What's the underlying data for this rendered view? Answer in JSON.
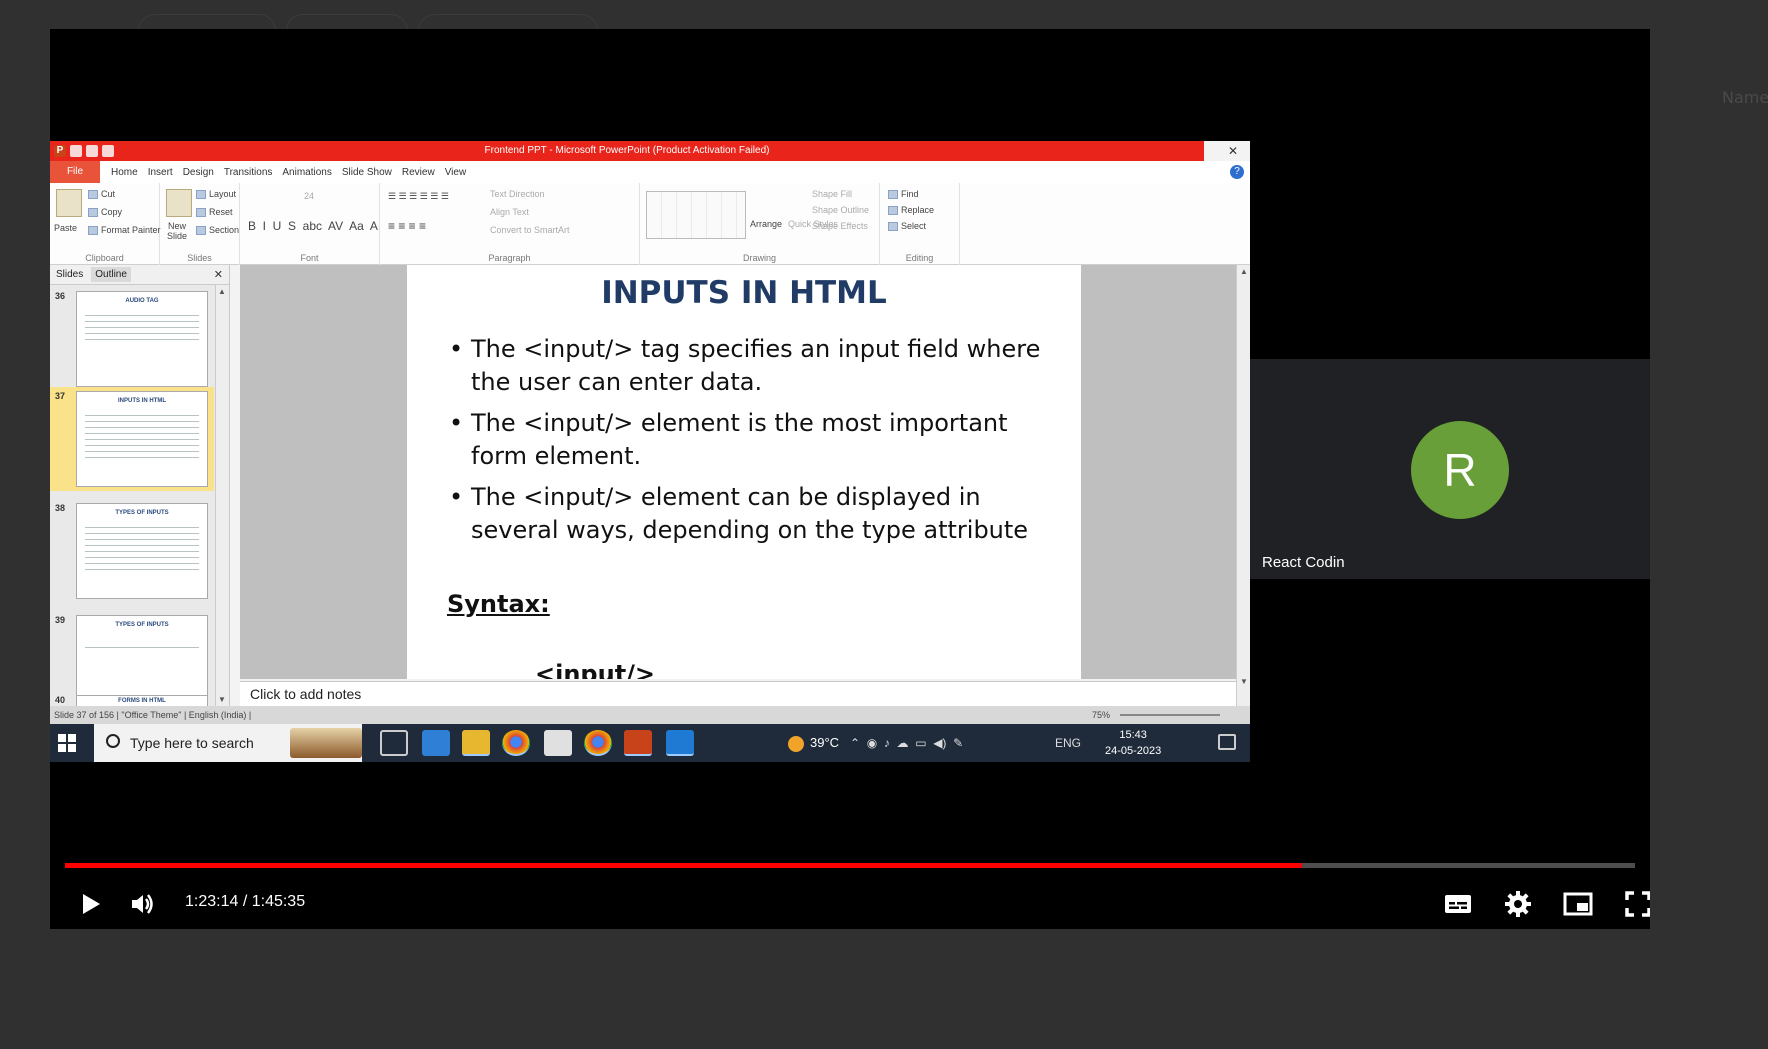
{
  "background": {
    "chips": [
      "",
      "",
      ""
    ],
    "name_label": "Name"
  },
  "ppt": {
    "window_title": "Frontend PPT - Microsoft PowerPoint (Product Activation Failed)",
    "ribbon_tabs": [
      "File",
      "Home",
      "Insert",
      "Design",
      "Transitions",
      "Animations",
      "Slide Show",
      "Review",
      "View"
    ],
    "ribbon": {
      "clipboard": {
        "paste": "Paste",
        "cut": "Cut",
        "copy": "Copy",
        "format_painter": "Format Painter",
        "label": "Clipboard"
      },
      "slides": {
        "new_slide": "New Slide",
        "layout": "Layout",
        "reset": "Reset",
        "section": "Section",
        "label": "Slides"
      },
      "font": {
        "size": "24",
        "label": "Font"
      },
      "paragraph": {
        "text_direction": "Text Direction",
        "align_text": "Align Text",
        "convert_smartart": "Convert to SmartArt",
        "label": "Paragraph"
      },
      "drawing": {
        "arrange": "Arrange",
        "quick_styles": "Quick Styles",
        "shape_fill": "Shape Fill",
        "shape_outline": "Shape Outline",
        "shape_effects": "Shape Effects",
        "label": "Drawing"
      },
      "editing": {
        "find": "Find",
        "replace": "Replace",
        "select": "Select",
        "label": "Editing"
      }
    },
    "pane_tabs": {
      "slides": "Slides",
      "outline": "Outline"
    },
    "thumbnails": [
      {
        "num": "36",
        "title": "AUDIO TAG"
      },
      {
        "num": "37",
        "title": "INPUTS IN HTML"
      },
      {
        "num": "38",
        "title": "TYPES OF INPUTS"
      },
      {
        "num": "39",
        "title": "TYPES OF INPUTS"
      },
      {
        "num": "40",
        "title": "FORMS IN HTML"
      }
    ],
    "slide": {
      "title": "INPUTS IN HTML",
      "bullets": [
        "The <input/> tag specifies an input field where the user can enter data.",
        "The <input/> element is the most important form element.",
        "The <input/> element can be displayed in several ways, depending on the type attribute"
      ],
      "syntax_label": "Syntax:",
      "syntax_code": "<input/>"
    },
    "notes_placeholder": "Click to add notes",
    "status": {
      "left": "Slide 37 of 156 | \"Office Theme\" | English (India) |",
      "zoom": "75%"
    }
  },
  "taskbar": {
    "search_placeholder": "Type here to search",
    "weather": "39°C",
    "language": "ENG",
    "time": "15:43",
    "date": "24-05-2023"
  },
  "participant": {
    "initial": "R",
    "name": "React Codin",
    "avatar_color": "#689f38"
  },
  "player": {
    "current_time": "1:23:14",
    "duration": "1:45:35",
    "time_display": "1:23:14 / 1:45:35",
    "progress_fraction": 0.788,
    "accent_color": "#ff0000"
  }
}
